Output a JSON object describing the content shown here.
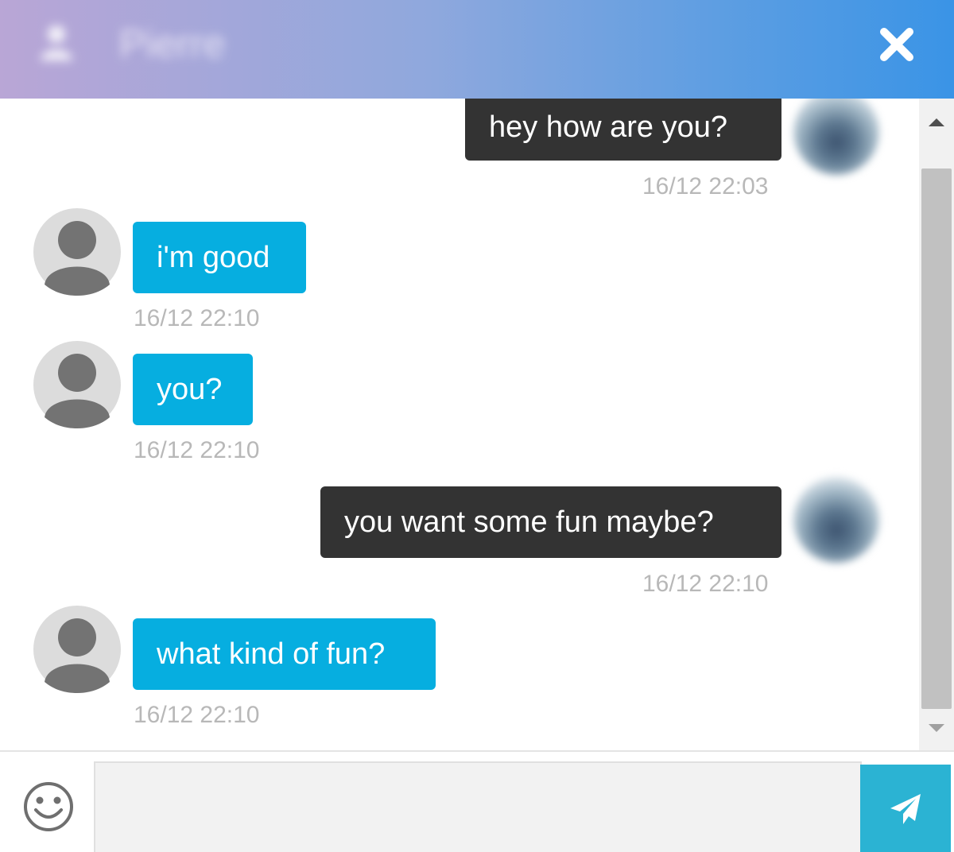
{
  "header": {
    "title": "Pierre",
    "close_icon": "close-icon",
    "gradient_start": "#b9a6d6",
    "gradient_end": "#3a94e6"
  },
  "messages": [
    {
      "direction": "sent",
      "text": "hey how are you?",
      "time": "16/12 22:03"
    },
    {
      "direction": "received",
      "text": "i'm good",
      "time": "16/12 22:10"
    },
    {
      "direction": "received",
      "text": "you?",
      "time": "16/12 22:10"
    },
    {
      "direction": "sent",
      "text": "you want some fun maybe?",
      "time": "16/12 22:10"
    },
    {
      "direction": "received",
      "text": "what kind of fun?",
      "time": "16/12 22:10"
    }
  ],
  "colors": {
    "sent_bubble": "#333333",
    "received_bubble": "#06aee0",
    "timestamp": "#b8b8b8",
    "send_button": "#2bb3d3"
  },
  "composer": {
    "input_value": "",
    "emoji_icon": "smiley-icon",
    "send_icon": "paper-plane-icon"
  }
}
